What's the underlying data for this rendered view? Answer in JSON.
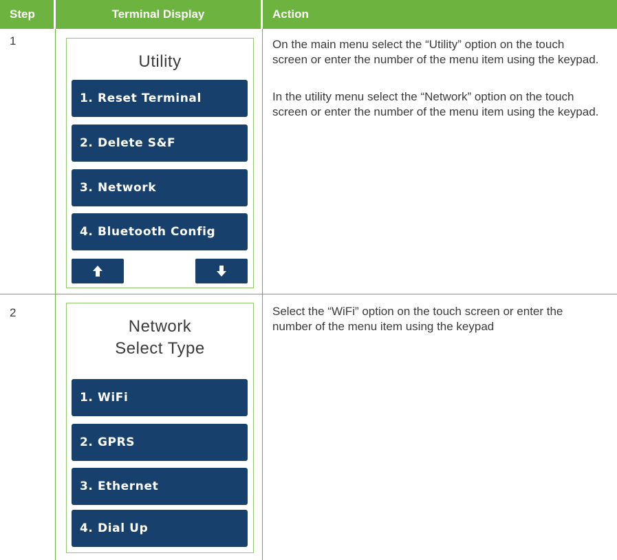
{
  "header": {
    "step": "Step",
    "display": "Terminal Display",
    "action": "Action"
  },
  "rows": [
    {
      "step": "1",
      "screen_title": "Utility",
      "menu": [
        "1. Reset Terminal",
        "2. Delete S&F",
        "3. Network",
        "4. Bluetooth Config"
      ],
      "nav_icons": [
        "arrow-up-icon",
        "arrow-down-icon"
      ],
      "action_paragraphs": [
        "On the main menu select the “Utility” option on the touch screen or enter the number of the menu item using the keypad.",
        "In the utility menu select the “Network” option on the touch screen or enter the number of the menu item using the keypad."
      ]
    },
    {
      "step": "2",
      "screen_title_line1": "Network",
      "screen_title_line2": "Select Type",
      "menu": [
        "1. WiFi",
        "2. GPRS",
        "3. Ethernet",
        "4. Dial Up"
      ],
      "action_paragraphs": [
        "Select the “WiFi” option on the touch screen or enter the number of the menu item using the keypad"
      ]
    }
  ],
  "colors": {
    "header_bg": "#6cb33f",
    "button_bg": "#17406d",
    "border": "#6cb33f",
    "text": "#3a3a3a"
  }
}
